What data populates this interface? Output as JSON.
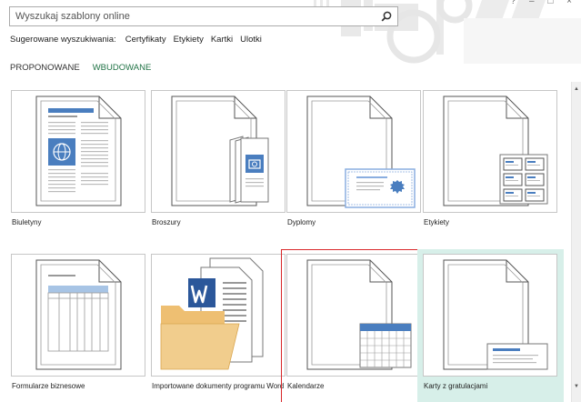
{
  "window": {
    "controls": "? ‒ □ ×"
  },
  "search": {
    "placeholder": "Wyszukaj szablony online",
    "value": "",
    "button_icon": "search-icon"
  },
  "suggested": {
    "label": "Sugerowane wyszukiwania:",
    "links": [
      "Certyfikaty",
      "Etykiety",
      "Kartki",
      "Ulotki"
    ]
  },
  "tabs": [
    {
      "label": "PROPONOWANE",
      "active": false
    },
    {
      "label": "WBUDOWANE",
      "active": true
    }
  ],
  "templates": [
    {
      "label": "Biuletyny",
      "icon": "newsletter-icon"
    },
    {
      "label": "Broszury",
      "icon": "brochure-icon"
    },
    {
      "label": "Dyplomy",
      "icon": "diploma-icon"
    },
    {
      "label": "Etykiety",
      "icon": "labels-icon"
    },
    {
      "label": "Formularze biznesowe",
      "icon": "business-form-icon"
    },
    {
      "label": "Importowane dokumenty programu Word",
      "icon": "word-folder-icon"
    },
    {
      "label": "Kalendarze",
      "icon": "calendar-icon",
      "selected": true
    },
    {
      "label": "Karty z gratulacjami",
      "icon": "greeting-card-icon",
      "hover": true
    }
  ],
  "colors": {
    "accent": "#217346",
    "selection": "#d9282a",
    "hover": "#d7efe9",
    "doc_blue": "#4a7ebf"
  }
}
